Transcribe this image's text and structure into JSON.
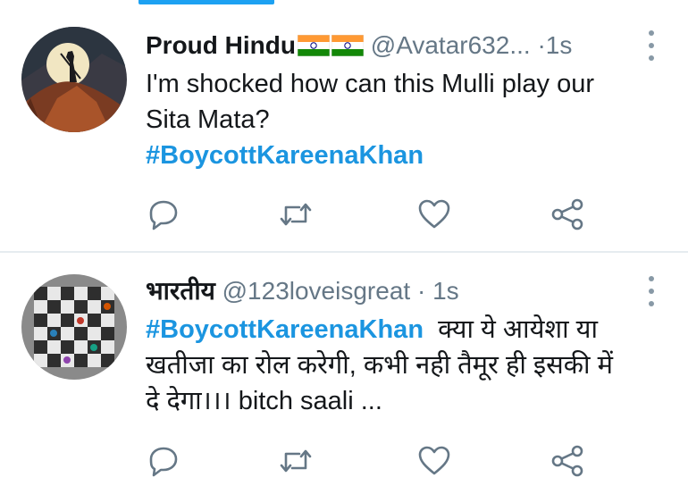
{
  "colors": {
    "accent": "#1da1f2",
    "hashtag": "#1b95e0",
    "muted": "#657786",
    "icon": "#657786",
    "divider": "#e6ecf0"
  },
  "tweets": [
    {
      "name": "Proud Hindu",
      "name_emoji": [
        "flag-india-icon",
        "flag-india-icon"
      ],
      "handle": "@Avatar632...",
      "separator": "·",
      "time": "1s",
      "text_lines": [
        "I'm shocked how can this Mulli play our",
        "Sita Mata?"
      ],
      "hashtag": "#BoycottKareenaKhan",
      "avatar": "silhouette-warrior-moon-avatar"
    },
    {
      "name": "भारतीय",
      "handle": "@123loveisgreat",
      "separator": "·",
      "time": "1s",
      "hashtag": "#BoycottKareenaKhan",
      "text_after_hashtag": "क्या ये आयेशा या",
      "text_lines": [
        "खतीजा का रोल करेगी, कभी नही तैमूर ही इसकी में",
        "दे देगा।।।  bitch saali ..."
      ],
      "avatar": "checkered-board-avatar"
    }
  ],
  "actions": [
    "reply-icon",
    "retweet-icon",
    "like-icon",
    "share-icon"
  ]
}
